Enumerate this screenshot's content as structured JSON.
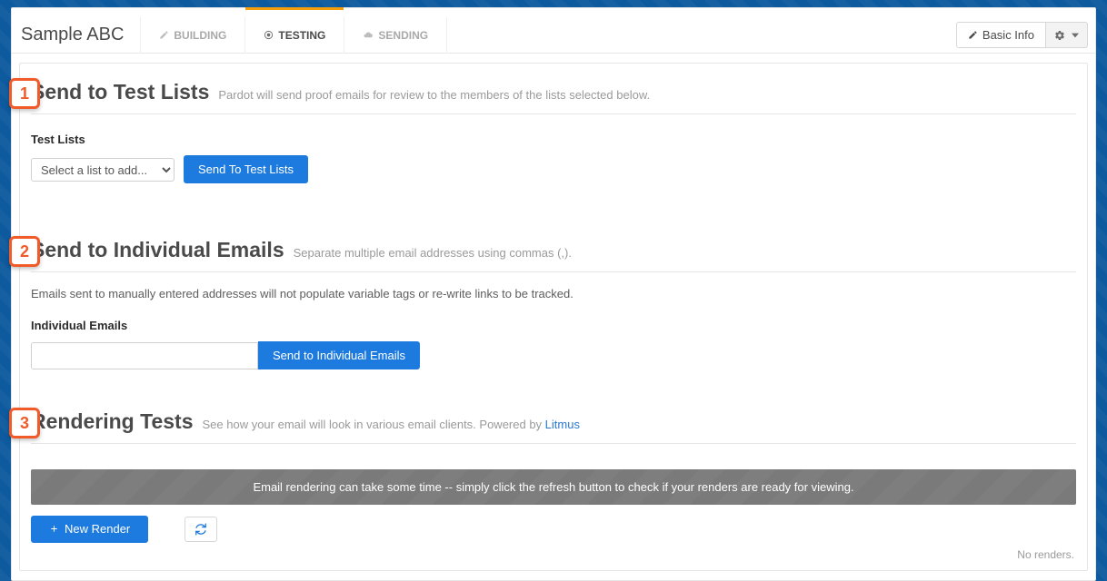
{
  "header": {
    "title": "Sample ABC",
    "tabs": [
      {
        "label": "BUILDING",
        "active": false
      },
      {
        "label": "TESTING",
        "active": true
      },
      {
        "label": "SENDING",
        "active": false
      }
    ],
    "basic_info_label": "Basic Info"
  },
  "steps": {
    "s1": {
      "badge": "1",
      "title": "Send to Test Lists",
      "sub": "Pardot will send proof emails for review to the members of the lists selected below.",
      "field_label": "Test Lists",
      "select_placeholder": "Select a list to add...",
      "button_label": "Send To Test Lists"
    },
    "s2": {
      "badge": "2",
      "title": "Send to Individual Emails",
      "sub": "Separate multiple email addresses using commas (,).",
      "note": "Emails sent to manually entered addresses will not populate variable tags or re-write links to be tracked.",
      "field_label": "Individual Emails",
      "input_value": "",
      "button_label": "Send to Individual Emails"
    },
    "s3": {
      "badge": "3",
      "title": "Rendering Tests",
      "sub_prefix": "See how your email will look in various email clients. Powered by ",
      "sub_link": "Litmus",
      "banner": "Email rendering can take some time -- simply click the refresh button to check if your renders are ready for viewing.",
      "new_render_label": "New Render",
      "no_renders": "No renders."
    }
  }
}
